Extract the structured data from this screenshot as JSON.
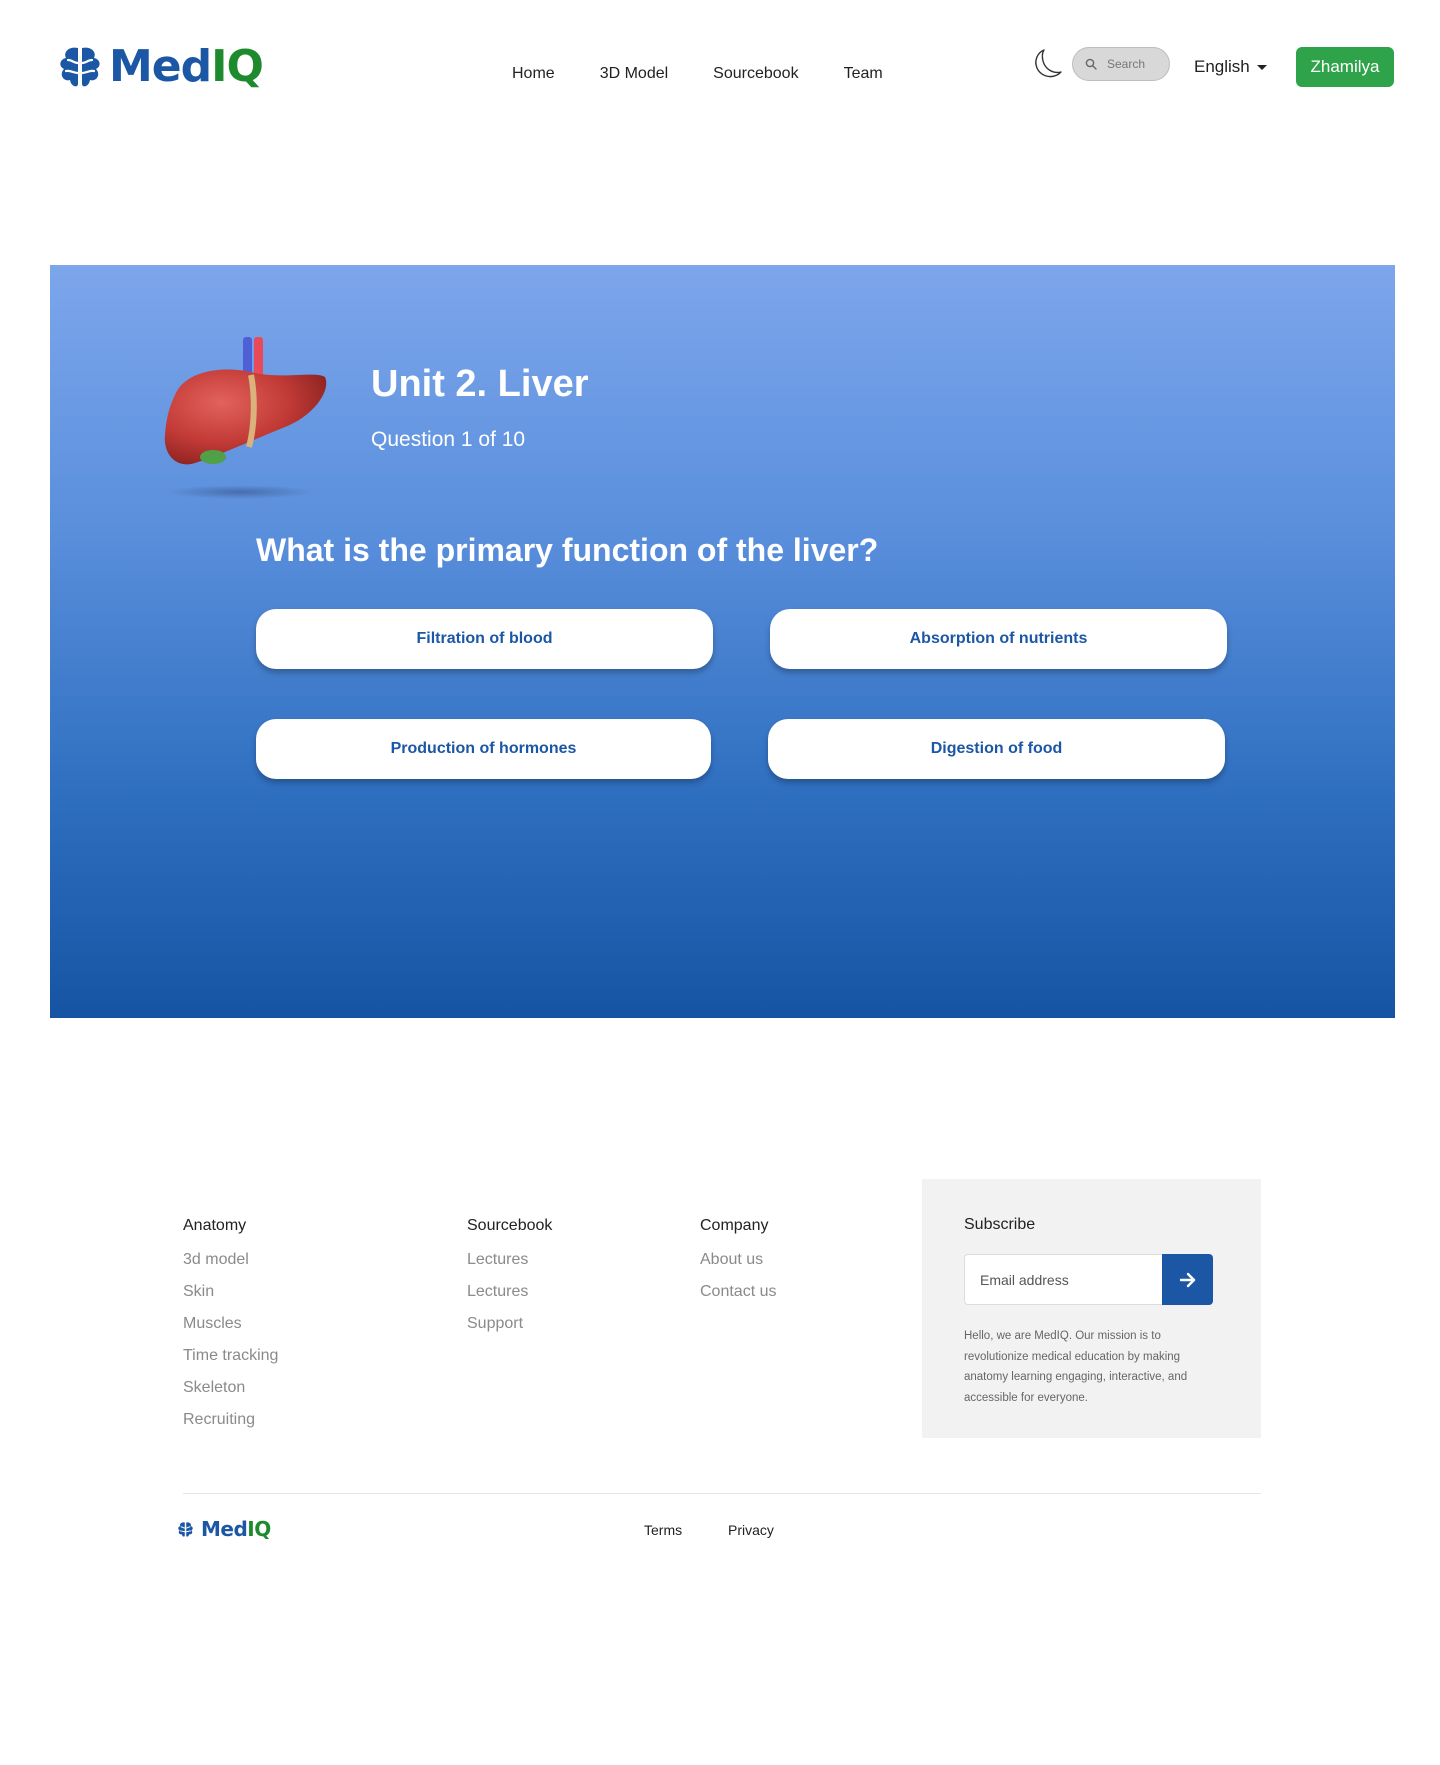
{
  "brand": {
    "name_part1": "Med",
    "name_part2": "IQ",
    "primary": "#1c57a6",
    "secondary": "#1e8a2e"
  },
  "nav": {
    "items": [
      {
        "label": "Home"
      },
      {
        "label": "3D Model"
      },
      {
        "label": "Sourcebook"
      },
      {
        "label": "Team"
      }
    ]
  },
  "header": {
    "theme_icon": "moon-icon",
    "search_placeholder": "Search",
    "language": "English",
    "user_name": "Zhamilya",
    "user_button_color": "#2fa34a"
  },
  "quiz": {
    "unit_title": "Unit 2. Liver",
    "counter": "Question 1 of 10",
    "question": "What is the primary function of the liver?",
    "answers": [
      {
        "label": "Filtration of blood"
      },
      {
        "label": "Absorption of nutrients"
      },
      {
        "label": "Production of hormones"
      },
      {
        "label": "Digestion of food"
      }
    ],
    "gradient_top": "#7da6ec",
    "gradient_bottom": "#1654a3"
  },
  "footer": {
    "columns": [
      {
        "title": "Anatomy",
        "links": [
          "3d model",
          "Skin",
          "Muscles",
          "Time tracking",
          "Skeleton",
          "Recruiting"
        ]
      },
      {
        "title": "Sourcebook",
        "links": [
          "Lectures",
          "Lectures",
          "Support"
        ]
      },
      {
        "title": "Company",
        "links": [
          "About us",
          "Contact us"
        ]
      }
    ],
    "subscribe": {
      "title": "Subscribe",
      "email_placeholder": "Email address",
      "submit_icon": "arrow-right-icon",
      "text": "Hello, we are MedIQ. Our mission is to revolutionize medical education by making anatomy learning engaging, interactive, and accessible for everyone."
    },
    "legal": {
      "terms": "Terms",
      "privacy": "Privacy"
    }
  }
}
